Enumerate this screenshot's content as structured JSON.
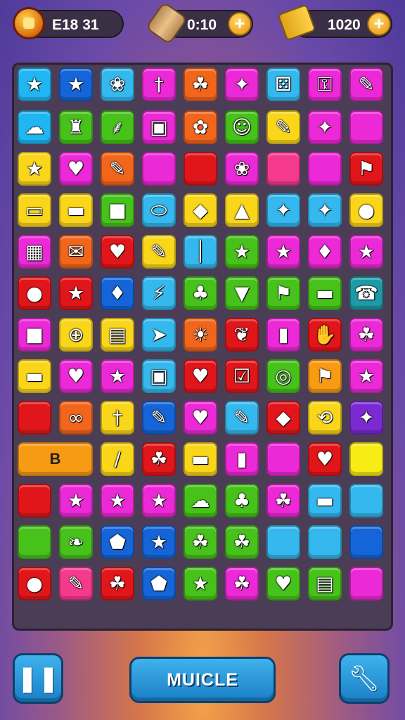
{
  "hud": {
    "coins": {
      "value": "E18  31",
      "icon": "coin-icon"
    },
    "timer": {
      "value": "0:10",
      "icon": "scroll-icon"
    },
    "tickets": {
      "value": "1020",
      "icon": "ticket-icon"
    },
    "plus_label": "+"
  },
  "palette": {
    "B": "#1fb6f2",
    "N": "#1565d8",
    "C": "#34b8ee",
    "M": "#ec29d6",
    "O": "#f2661c",
    "Y": "#f9d61a",
    "G": "#46c21a",
    "R": "#e1161a",
    "K": "#f53a8c",
    "P": "#a545e0",
    "L": "#f7ec14",
    "A": "#f79a14",
    "T": "#1d9aa5",
    "V": "#7a2ad0"
  },
  "board": {
    "rows": [
      [
        "B:star-icon",
        "N:star-icon",
        "C:bow-icon",
        "M:wand-icon",
        "O:leaf-icon",
        "M:pinwheel-icon",
        "C:dice-icon",
        "M:key-icon",
        "M:pencil-icon"
      ],
      [
        "B:cloud-icon",
        "G:castle-icon",
        "G:palm-tree-icon",
        "M:camera-icon",
        "O:flower-icon",
        "G:face-icon",
        "Y:pencil-icon",
        "M:cat-icon",
        "M:"
      ],
      [
        "Y:star-icon",
        "M:heart-icon",
        "O:pencil-icon",
        "M:",
        "R:",
        "M:brush-icon",
        "K:",
        "M:",
        "R:flag-icon"
      ],
      [
        "Y:card-icon",
        "Y:ruler-icon",
        "G:box-icon",
        "C:pill-icon",
        "Y:kite-icon",
        "Y:triangle-icon",
        "C:sparkle-icon",
        "C:sparkle-icon",
        "Y:bun-icon"
      ],
      [
        "M:calculator-icon",
        "O:envelope-icon",
        "R:heart-icon",
        "Y:pencil-icon",
        "C:stick-icon",
        "G:star-icon",
        "M:star-icon",
        "M:diamond-icon",
        "M:star-icon"
      ],
      [
        "R:balloon-icon",
        "R:star-icon",
        "N:diamond-icon",
        "C:flashlight-icon",
        "G:bell-icon",
        "G:shield-icon",
        "G:flag-icon",
        "G:ruler-icon",
        "T:phone-icon"
      ],
      [
        "M:bag-icon",
        "Y:lollipop-icon",
        "Y:newspaper-icon",
        "C:paper-plane-icon",
        "O:sun-icon",
        "R:rabbit-icon",
        "M:bottle-icon",
        "R:mitten-icon",
        "M:leaf-icon"
      ],
      [
        "Y:ticket-icon",
        "M:heart-icon",
        "M:star-icon",
        "C:jar-icon",
        "R:heart-icon",
        "R:check-box-icon",
        "G:ring-icon",
        "A:flag-icon",
        "M:star-icon"
      ],
      [
        "R:",
        "O:glasses-icon",
        "Y:bone-icon",
        "N:pencil-icon",
        "M:heart-icon",
        "C:pencil-icon",
        "R:kite-icon",
        "Y:rope-icon",
        "V:sparkle-icon"
      ],
      [
        "A:B",
        "R:",
        "Y:slash-icon",
        "R:leaf-icon",
        "Y:ruler-icon",
        "M:book-icon",
        "M:",
        "R:heart-icon",
        "L:"
      ],
      [
        "R:",
        "M:star-icon",
        "M:star-icon",
        "M:star-icon",
        "G:bubble-icon",
        "G:boot-icon",
        "M:leaf-icon",
        "C:eraser-icon",
        "C:"
      ],
      [
        "G:",
        "G:bird-icon",
        "N:tag-icon",
        "N:star-icon",
        "G:apple-icon",
        "G:leaf-icon",
        "C:",
        "C:",
        "N:"
      ],
      [
        "R:dot-icon",
        "K:crayon-icon",
        "R:leaf-icon",
        "N:pentagon-icon",
        "G:star-icon",
        "M:leaf-icon",
        "G:heart-icon",
        "G:toolbox-icon",
        "M:"
      ]
    ]
  },
  "buttons": {
    "left": {
      "icon": "pause-icon"
    },
    "main": {
      "label": "MUICLE"
    },
    "right": {
      "icon": "wrench-icon"
    }
  }
}
